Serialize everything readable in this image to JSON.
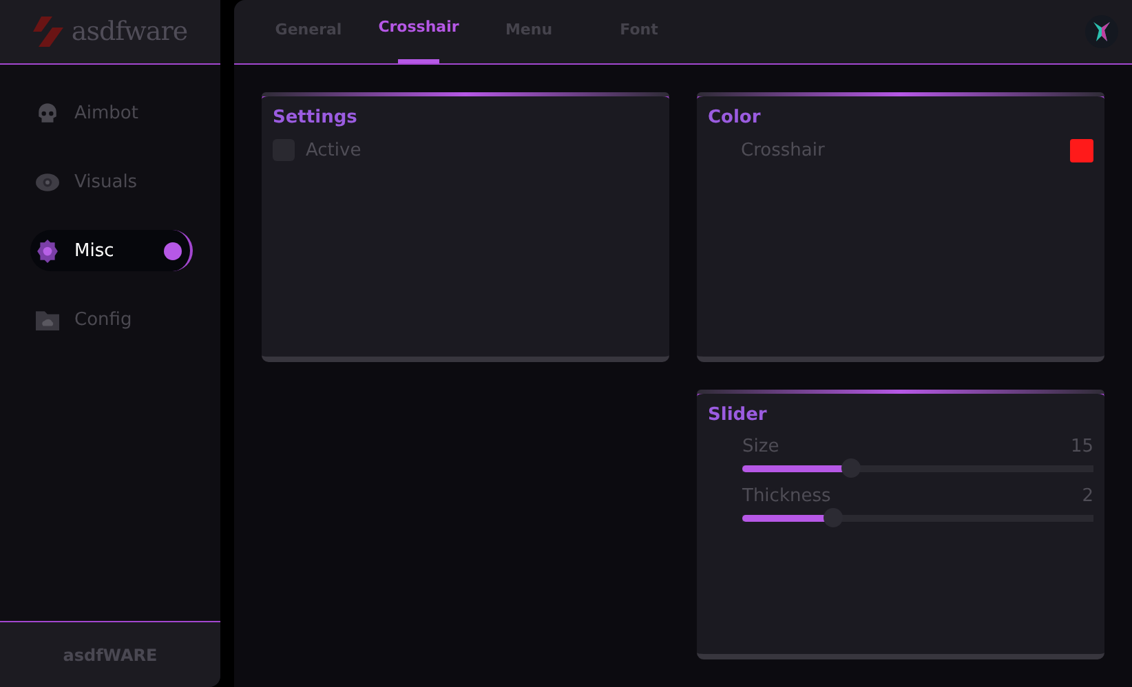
{
  "logo": {
    "text": "asdfware"
  },
  "sidebar": {
    "items": [
      {
        "label": "Aimbot",
        "selected": false
      },
      {
        "label": "Visuals",
        "selected": false
      },
      {
        "label": "Misc",
        "selected": true
      },
      {
        "label": "Config",
        "selected": false
      }
    ],
    "footer": "asdfWARE"
  },
  "tabs": [
    {
      "label": "General",
      "selected": false
    },
    {
      "label": "Crosshair",
      "selected": true
    },
    {
      "label": "Menu",
      "selected": false
    },
    {
      "label": "Font",
      "selected": false
    }
  ],
  "panels": {
    "settings": {
      "title": "Settings",
      "checkbox": {
        "label": "Active",
        "checked": false
      }
    },
    "color": {
      "title": "Color",
      "rows": [
        {
          "label": "Crosshair",
          "color": "#ff1a1a"
        }
      ]
    },
    "slider": {
      "title": "Slider",
      "sliders": [
        {
          "label": "Size",
          "reading": "15",
          "level": 0.31
        },
        {
          "label": "Thickness",
          "reading": "2",
          "level": 0.26
        }
      ]
    }
  }
}
